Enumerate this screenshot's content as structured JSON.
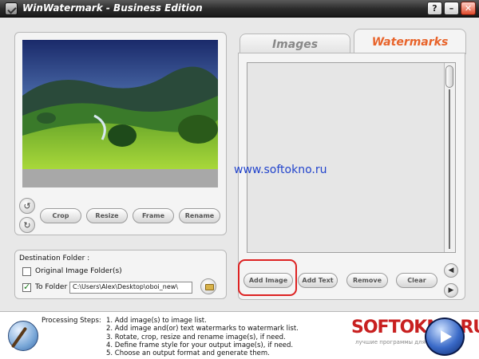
{
  "window": {
    "title": "WinWatermark - Business Edition",
    "buttons": [
      "?",
      "–",
      "✕"
    ]
  },
  "image_tools": {
    "crop_label": "Crop",
    "resize_label": "Resize",
    "frame_label": "Frame",
    "rename_label": "Rename"
  },
  "destination": {
    "title": "Destination Folder :",
    "original_label": "Original Image Folder(s)",
    "original_checked": false,
    "to_folder_label": "To Folder",
    "to_folder_checked": true,
    "path_value": "C:\\Users\\Alex\\Desktop\\oboi_new\\"
  },
  "tabs": {
    "images_label": "Images",
    "watermarks_label": "Watermarks",
    "active": "Watermarks"
  },
  "watermark_actions": {
    "add_image_label": "Add Image",
    "add_text_label": "Add Text",
    "remove_label": "Remove",
    "clear_label": "Clear"
  },
  "overlay_url": "www.softokno.ru",
  "processing": {
    "label": "Processing Steps:",
    "steps": [
      "1. Add image(s) to image list.",
      "2. Add image and(or) text watermarks to watermark list.",
      "3. Rotate, crop, resize and rename image(s), if need.",
      "4. Define frame style for your output image(s), if need.",
      "5. Choose an output format and generate them."
    ]
  },
  "brand": {
    "name": "SOFTOKNO.RU",
    "tagline": "лучшие программы для сети"
  },
  "colors": {
    "accent_tab": "#e8632a",
    "url": "#2244cc",
    "highlight": "#dd2222",
    "brand": "#c82020"
  }
}
